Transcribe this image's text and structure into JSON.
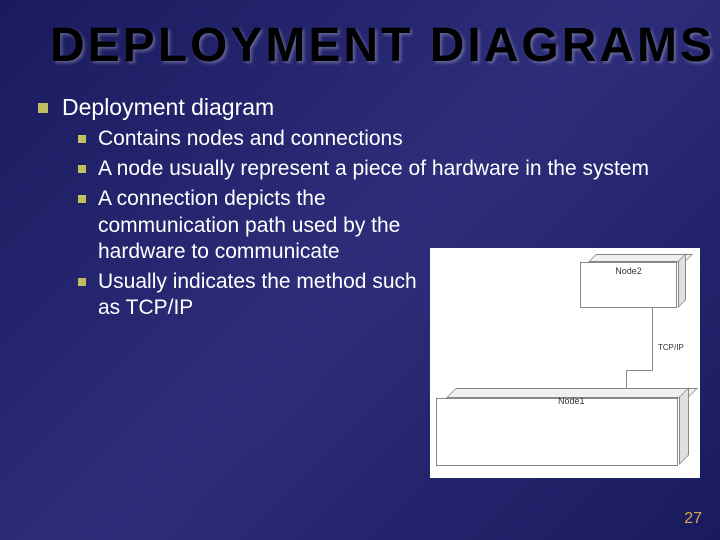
{
  "title": "DEPLOYMENT DIAGRAMS",
  "bullets": {
    "l1": "Deployment diagram",
    "l2a": "Contains nodes and connections",
    "l2b": "A node usually represent a piece of hardware in the system",
    "l2c": "A connection depicts the communication path used by the hardware to communicate",
    "l2d": "Usually indicates the method such as TCP/IP"
  },
  "diagram": {
    "node2_label": "Node2",
    "node1_label": "Node1",
    "connection_label": "TCP/IP"
  },
  "page_number": "27"
}
